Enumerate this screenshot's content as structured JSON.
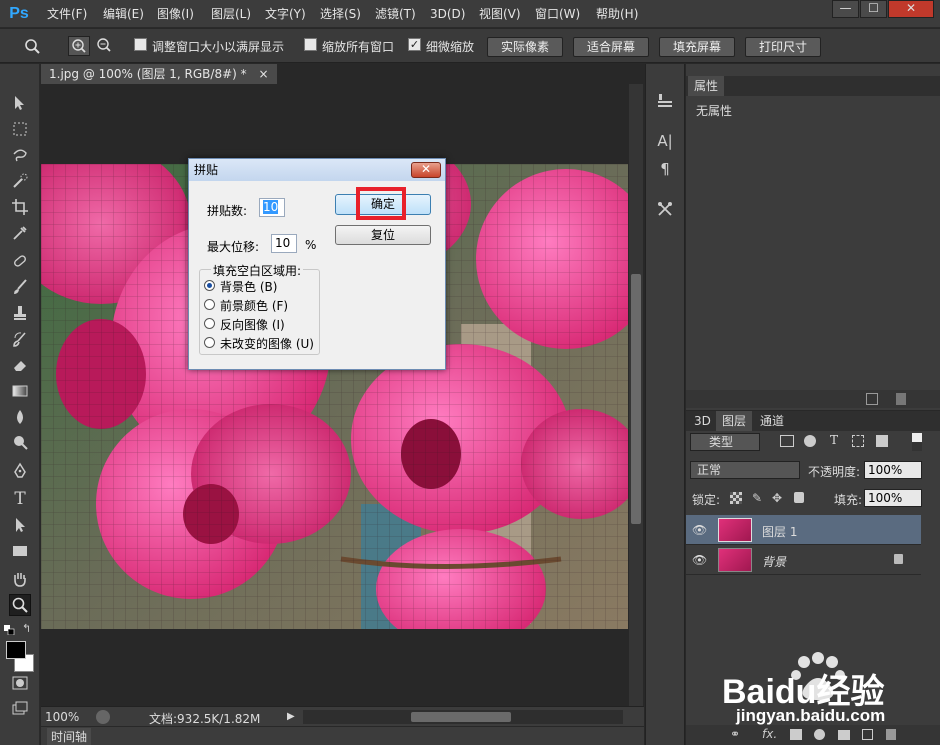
{
  "app": {
    "logo": "Ps"
  },
  "menu": [
    "文件(F)",
    "编辑(E)",
    "图像(I)",
    "图层(L)",
    "文字(Y)",
    "选择(S)",
    "滤镜(T)",
    "3D(D)",
    "视图(V)",
    "窗口(W)",
    "帮助(H)"
  ],
  "window_controls": {
    "minimize": "—",
    "restore": "☐",
    "close": "✕"
  },
  "options": {
    "resize_windows": {
      "label": "调整窗口大小以满屏显示",
      "checked": false
    },
    "zoom_all": {
      "label": "缩放所有窗口",
      "checked": false
    },
    "scrubby_zoom": {
      "label": "细微缩放",
      "checked": true
    },
    "buttons": [
      "实际像素",
      "适合屏幕",
      "填充屏幕",
      "打印尺寸"
    ]
  },
  "document": {
    "tab_title": "1.jpg @ 100% (图层 1, RGB/8#) *",
    "tab_close": "×"
  },
  "status": {
    "zoom": "100%",
    "doc_info": "文档:932.5K/1.82M"
  },
  "timeline": {
    "label": "时间轴"
  },
  "properties": {
    "tab": "属性",
    "content": "无属性"
  },
  "layers_panel": {
    "tabs": [
      "3D",
      "图层",
      "通道"
    ],
    "filter_kind": "类型",
    "blend_mode": "正常",
    "opacity_label": "不透明度:",
    "opacity_value": "100%",
    "lock_label": "锁定:",
    "fill_label": "填充:",
    "fill_value": "100%",
    "layers": [
      {
        "name": "图层 1",
        "selected": true,
        "locked": false
      },
      {
        "name": "背景",
        "selected": false,
        "locked": true
      }
    ]
  },
  "dialog": {
    "title": "拼贴",
    "tiles_label": "拼贴数:",
    "tiles_value": "10",
    "offset_label": "最大位移:",
    "offset_value": "10",
    "offset_unit": "%",
    "fill_group_label": "填充空白区域用:",
    "options": [
      {
        "label": "背景色 (B)",
        "selected": true
      },
      {
        "label": "前景颜色 (F)",
        "selected": false
      },
      {
        "label": "反向图像 (I)",
        "selected": false
      },
      {
        "label": "未改变的图像 (U)",
        "selected": false
      }
    ],
    "ok": "确定",
    "reset": "复位",
    "highlight_color": "#e8202a"
  },
  "watermark": {
    "brand": "Baidu经验",
    "url": "jingyan.baidu.com"
  },
  "colors": {
    "accent": "#31a8ff",
    "selection": "#5a6b80",
    "canvas_pink": "#e0307a"
  }
}
